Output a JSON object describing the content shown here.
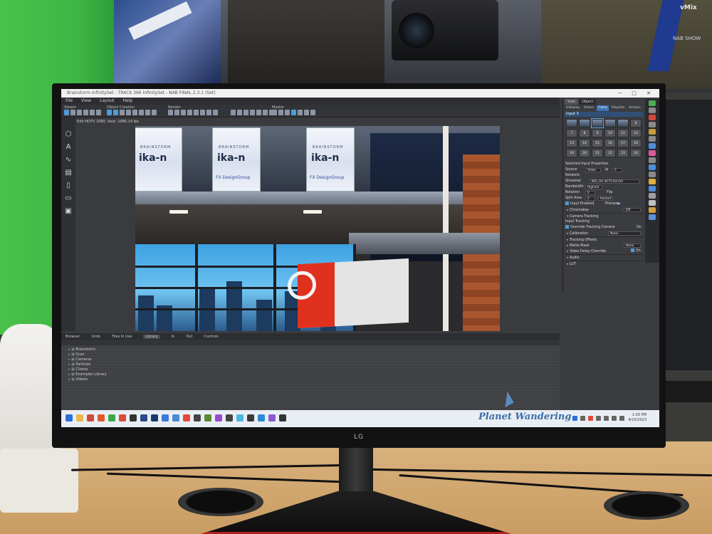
{
  "window": {
    "title": "Brainstorm InfinitySet - TRACK 366 InfinitySet - NAB FINAL 2.3.1 (Set)"
  },
  "menu": [
    "File",
    "View",
    "Layout",
    "Help"
  ],
  "toolbar_groups": [
    "Viewer",
    "Object Creation",
    "Render",
    "Master"
  ],
  "viewport": {
    "status": "Edit HDTV 1080, Vout: 1080.14 fps",
    "banner_brand": "BRAINSTORM",
    "banner_logo": "ika-n",
    "banner_fx": "FX DesignGroup"
  },
  "browser_tabs": [
    "Browser",
    "Undo",
    "Files In Use",
    "Library",
    "In",
    "Out",
    "Controls"
  ],
  "browser_items": [
    "Brainstorm",
    "Scan",
    "Cameras",
    "Particles",
    "Clients",
    "Examples Library",
    "Videos"
  ],
  "right_panel": {
    "tabs": [
      "Vset",
      "Object"
    ],
    "subtabs": [
      "Vdisplay",
      "Actors",
      "Cams",
      "Playlists",
      "Actions",
      "Misc"
    ],
    "input_label": "Input 3",
    "grid": [
      "",
      "",
      "",
      "",
      "",
      "6",
      "7",
      "8",
      "9",
      "10",
      "11",
      "12",
      "13",
      "14",
      "15",
      "16",
      "17",
      "18",
      "19",
      "20",
      "21",
      "22",
      "23",
      "24"
    ],
    "selected_props": "Selected Input Properties",
    "source_label": "Source",
    "source_value": "Video",
    "ip_label": "Ip",
    "ip_value": "2",
    "network_label": "Network",
    "streamer_label": "Streamer",
    "streamer_value": "NDI_HX (KTTCX4-V4)",
    "bandwidth_label": "Bandwidth",
    "bandwidth_value": "Highest",
    "rotation_label": "Rotation",
    "rotation_value": "0",
    "flip_label": "Flip",
    "split_label": "Split Area",
    "split_value": "2",
    "restart_label": "Restart",
    "input_enabled": "Input Enabled",
    "preview_label": "Preview",
    "chromakey_label": "Chromakey",
    "chromakey_value": "Off",
    "camera_tracking": "Camera Tracking",
    "input_tracking": "Input Tracking",
    "override_label": "Override Tracking Camera",
    "override_value": "On",
    "calibration_label": "Calibration",
    "calibration_value": "None",
    "tracking_offsets": "Tracking Offsets",
    "matte_mask": "Matte Mask",
    "matte_value": "None",
    "video_delay": "Video Delay Override",
    "video_delay_value": "On",
    "audio": "Audio",
    "lut": "LUT"
  },
  "taskbar": {
    "time": "1:03 PM",
    "date": "4/15/2023"
  },
  "monitor_brand": "LG",
  "watermark": "Planet Wandering",
  "lanyard": {
    "line1": "vMix",
    "line2": "NAB SHOW"
  }
}
